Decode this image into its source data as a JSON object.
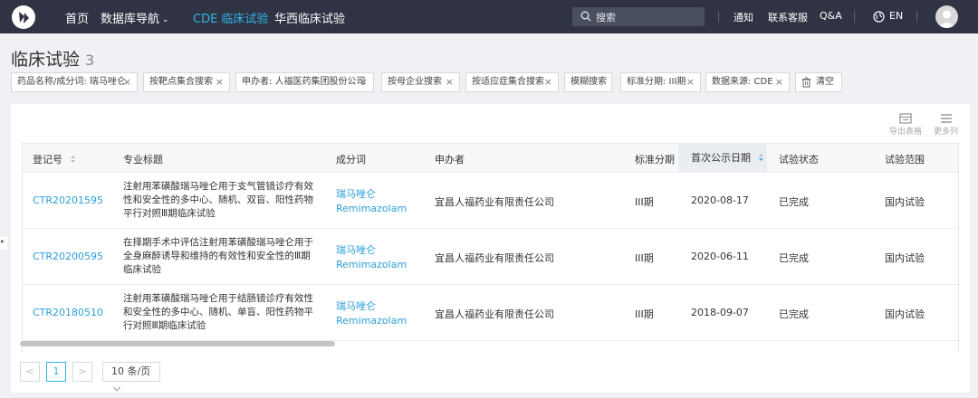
{
  "nav": {
    "items": [
      {
        "label": "首页"
      },
      {
        "label": "数据库导航"
      },
      {
        "label": "CDE 临床试验"
      },
      {
        "label": "华西临床试验"
      }
    ],
    "search_placeholder": "搜索",
    "right": [
      {
        "label": "通知"
      },
      {
        "label": "联系客服"
      },
      {
        "label": "Q&A"
      }
    ],
    "lang": "EN",
    "accent_color": "#32b4e6",
    "bar_color": "#2f3343"
  },
  "page": {
    "title": "临床试验",
    "count": "3"
  },
  "filters": [
    {
      "label": "药品名称/成分词: 瑞马唑仑"
    },
    {
      "label": "按靶点集合搜索"
    },
    {
      "label": "申办者: 人福医药集团股份公司"
    },
    {
      "label": "按母企业搜索"
    },
    {
      "label": "按适应症集合搜索"
    },
    {
      "label": "模糊搜索"
    },
    {
      "label": "标准分期: III期"
    },
    {
      "label": "数据来源: CDE"
    }
  ],
  "clear_label": "清空",
  "tools": {
    "export": "导出表格",
    "more_cols": "更多列"
  },
  "table": {
    "headers": [
      "登记号",
      "专业标题",
      "成分词",
      "申办者",
      "标准分期",
      "首次公示日期",
      "试验状态",
      "试验范围"
    ],
    "rows": [
      {
        "id": "CTR20201595",
        "title": "注射用苯磺酸瑞马唑仑用于支气管镜诊疗有效性和安全性的多中心、随机、双盲、阳性药物平行对照Ⅲ期临床试验",
        "comp_cn": "瑞马唑仑",
        "comp_en": "Remimazolam",
        "sponsor": "宜昌人福药业有限责任公司",
        "phase": "III期",
        "date": "2020-08-17",
        "status": "已完成",
        "scope": "国内试验"
      },
      {
        "id": "CTR20200595",
        "title": "在择期手术中评估注射用苯磺酸瑞马唑仑用于全身麻醉诱导和维持的有效性和安全性的Ⅲ期临床试验",
        "comp_cn": "瑞马唑仑",
        "comp_en": "Remimazolam",
        "sponsor": "宜昌人福药业有限责任公司",
        "phase": "III期",
        "date": "2020-06-11",
        "status": "已完成",
        "scope": "国内试验"
      },
      {
        "id": "CTR20180510",
        "title": "注射用苯磺酸瑞马唑仑用于结肠镜诊疗有效性和安全性的多中心、随机、单盲、阳性药物平行对照Ⅲ期临床试验",
        "comp_cn": "瑞马唑仑",
        "comp_en": "Remimazolam",
        "sponsor": "宜昌人福药业有限责任公司",
        "phase": "III期",
        "date": "2018-09-07",
        "status": "已完成",
        "scope": "国内试验"
      }
    ]
  },
  "pagination": {
    "prev": "<",
    "current": "1",
    "next": ">",
    "page_size": "10 条/页"
  }
}
